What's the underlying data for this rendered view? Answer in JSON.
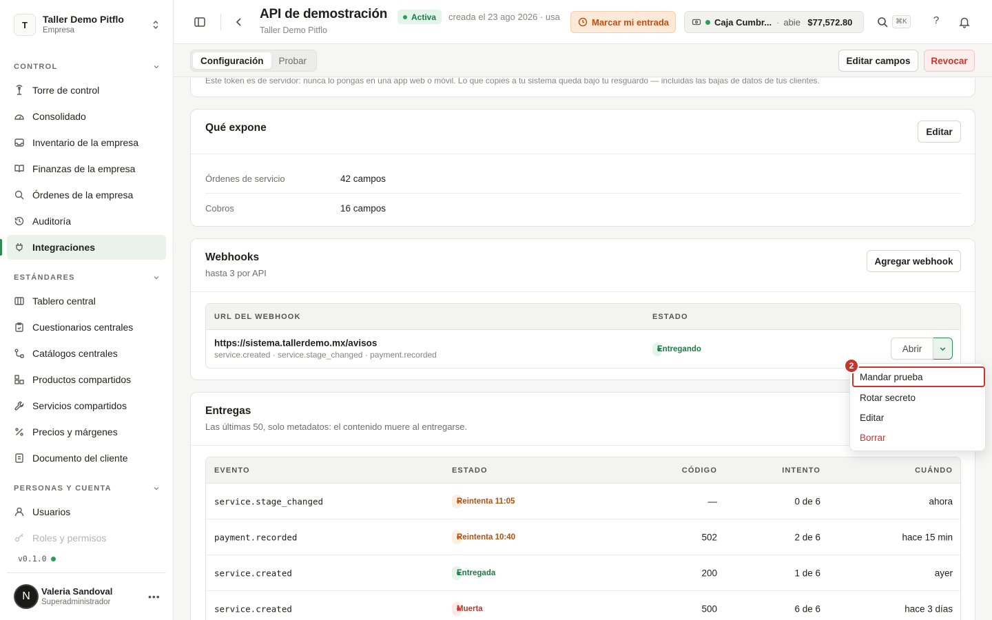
{
  "workspace": {
    "initial": "T",
    "name": "Taller Demo Pitflo",
    "type": "Empresa"
  },
  "sidebar": {
    "sections": [
      {
        "label": "CONTROL",
        "items": [
          "Torre de control",
          "Consolidado",
          "Inventario de la empresa",
          "Finanzas de la empresa",
          "Órdenes de la empresa",
          "Auditoría",
          "Integraciones"
        ]
      },
      {
        "label": "ESTÁNDARES",
        "items": [
          "Tablero central",
          "Cuestionarios centrales",
          "Catálogos centrales",
          "Productos compartidos",
          "Servicios compartidos",
          "Precios y márgenes",
          "Documento del cliente"
        ]
      },
      {
        "label": "PERSONAS Y CUENTA",
        "items": [
          "Usuarios",
          "Roles y permisos"
        ]
      }
    ],
    "active_item": "Integraciones",
    "version": "v0.1.0"
  },
  "user": {
    "initial": "N",
    "name": "Valeria Sandoval",
    "role": "Superadministrador"
  },
  "header": {
    "title": "API de demostración",
    "subtitle": "Taller Demo Pitflo",
    "status": "Activa",
    "created": "creada el 23 ago 2026 · usa",
    "clock_in_label": "Marcar mi entrada",
    "register": {
      "name": "Caja Cumbr...",
      "state": "abie",
      "amount": "$77,572.80"
    },
    "search_shortcut": "⌘K",
    "help_label": "?"
  },
  "subbar": {
    "tabs": [
      "Configuración",
      "Probar"
    ],
    "active_tab": "Configuración",
    "edit_fields_label": "Editar campos",
    "revoke_label": "Revocar"
  },
  "token_note": "Este token es de servidor: nunca lo pongas en una app web o móvil. Lo que copies a tu sistema queda bajo tu resguardo — incluidas las bajas de datos de tus clientes.",
  "exposes": {
    "title": "Qué expone",
    "edit_label": "Editar",
    "rows": [
      {
        "name": "Órdenes de servicio",
        "value": "42 campos"
      },
      {
        "name": "Cobros",
        "value": "16 campos"
      }
    ]
  },
  "webhooks": {
    "title": "Webhooks",
    "subtitle": "hasta 3 por API",
    "add_label": "Agregar webhook",
    "columns": [
      "URL DEL WEBHOOK",
      "ESTADO"
    ],
    "rows": [
      {
        "url": "https://sistema.tallerdemo.mx/avisos",
        "events": "service.created · service.stage_changed · payment.recorded",
        "status": "Entregando",
        "open_label": "Abrir"
      }
    ]
  },
  "menu": {
    "badge": "2",
    "items": [
      "Mandar prueba",
      "Rotar secreto",
      "Editar",
      "Borrar"
    ],
    "highlighted": "Mandar prueba"
  },
  "deliveries": {
    "title": "Entregas",
    "subtitle": "Las últimas 50, solo metadatos: el contenido muere al entregarse.",
    "columns": [
      "EVENTO",
      "ESTADO",
      "CÓDIGO",
      "INTENTO",
      "CUÁNDO"
    ],
    "rows": [
      {
        "event": "service.stage_changed",
        "status": "Reintenta 11:05",
        "tone": "orange",
        "code": "—",
        "attempt": "0 de 6",
        "when": "ahora"
      },
      {
        "event": "payment.recorded",
        "status": "Reintenta 10:40",
        "tone": "orange",
        "code": "502",
        "attempt": "2 de 6",
        "when": "hace 15 min"
      },
      {
        "event": "service.created",
        "status": "Entregada",
        "tone": "green",
        "code": "200",
        "attempt": "1 de 6",
        "when": "ayer"
      },
      {
        "event": "service.created",
        "status": "Muerta",
        "tone": "red",
        "code": "500",
        "attempt": "6 de 6",
        "when": "hace 3 días"
      }
    ]
  },
  "colors": {
    "accent": "#2a8c4f",
    "danger": "#c6342b",
    "warning": "#c24d0f"
  }
}
